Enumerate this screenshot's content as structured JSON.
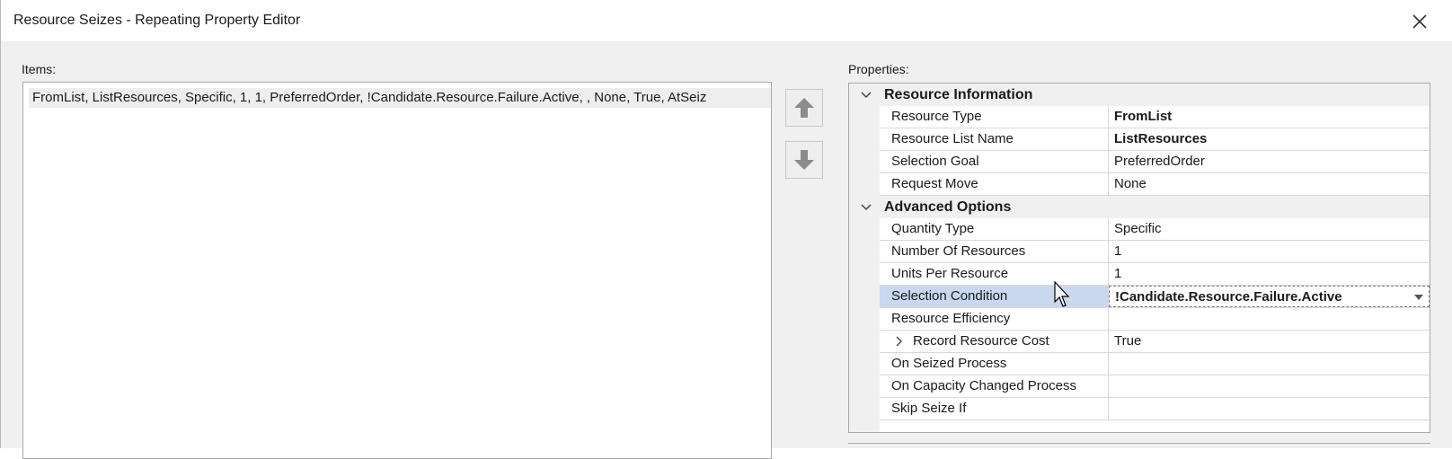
{
  "window": {
    "title": "Resource Seizes - Repeating Property Editor",
    "close_icon": "close-icon"
  },
  "items": {
    "label": "Items:",
    "rows": [
      "FromList, ListResources, Specific, 1, 1, PreferredOrder, !Candidate.Resource.Failure.Active, , None, True, AtSeiz"
    ]
  },
  "move_buttons": {
    "up_icon": "arrow-up-icon",
    "down_icon": "arrow-down-icon"
  },
  "properties": {
    "label": "Properties:",
    "categories": [
      {
        "label": "Resource Information",
        "rows": [
          {
            "name": "Resource Type",
            "value": "FromList"
          },
          {
            "name": "Resource List Name",
            "value": "ListResources"
          },
          {
            "name": "Selection Goal",
            "value": "PreferredOrder"
          },
          {
            "name": "Request Move",
            "value": "None"
          }
        ]
      },
      {
        "label": "Advanced Options",
        "rows": [
          {
            "name": "Quantity Type",
            "value": "Specific"
          },
          {
            "name": "Number Of Resources",
            "value": "1"
          },
          {
            "name": "Units Per Resource",
            "value": "1"
          },
          {
            "name": "Selection Condition",
            "value": "!Candidate.Resource.Failure.Active"
          },
          {
            "name": "Resource Efficiency",
            "value": ""
          },
          {
            "name": "Record Resource Cost",
            "value": "True"
          },
          {
            "name": "On Seized Process",
            "value": ""
          },
          {
            "name": "On Capacity Changed Process",
            "value": ""
          },
          {
            "name": "Skip Seize If",
            "value": ""
          }
        ]
      }
    ]
  },
  "colors": {
    "selected_row": "#c9d8ef",
    "category_bg": "#f0f0f0",
    "dialog_bg": "#f0f0f0"
  }
}
